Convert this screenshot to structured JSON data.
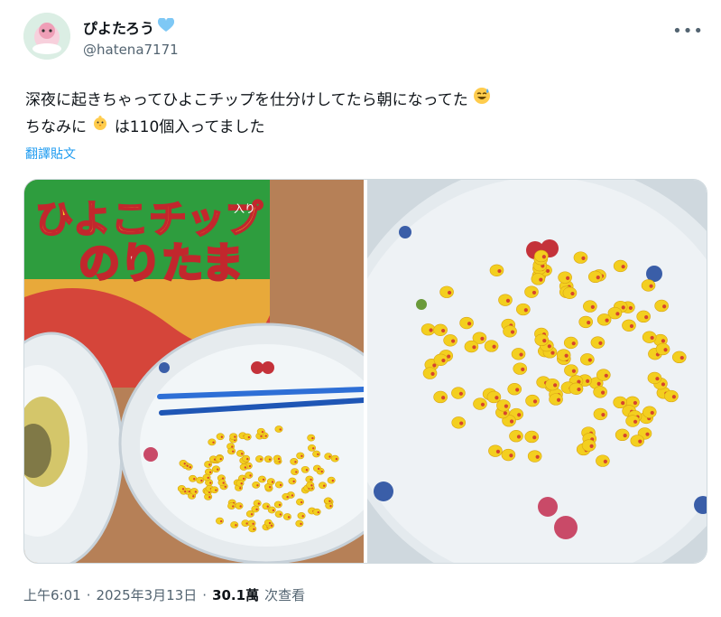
{
  "user": {
    "display_name": "ぴよたろう",
    "handle": "@hatena7171"
  },
  "tweet": {
    "line1": "深夜に起きちゃってひよこチップを仕分けしてたら朝になってた",
    "line2_prefix": "ちなみに",
    "line2_suffix": "は110個入ってました",
    "translate_label": "翻譯貼文"
  },
  "media": {
    "package_text_top": "ひよこチップ",
    "package_text_small": "入り",
    "package_text_main": "のりたま"
  },
  "meta": {
    "time": "上午6:01",
    "separator1": "·",
    "date": "2025年3月13日",
    "separator2": "·",
    "views_count": "30.1萬",
    "views_label": "次查看"
  },
  "icons": {
    "heart": "blue-heart-icon",
    "more": "more-icon",
    "sweat_smile": "sweat-smile-emoji-icon",
    "chick": "chick-emoji-icon"
  },
  "colors": {
    "link": "#1d9bf0",
    "muted": "#536471",
    "heart": "#7ec8f5"
  }
}
